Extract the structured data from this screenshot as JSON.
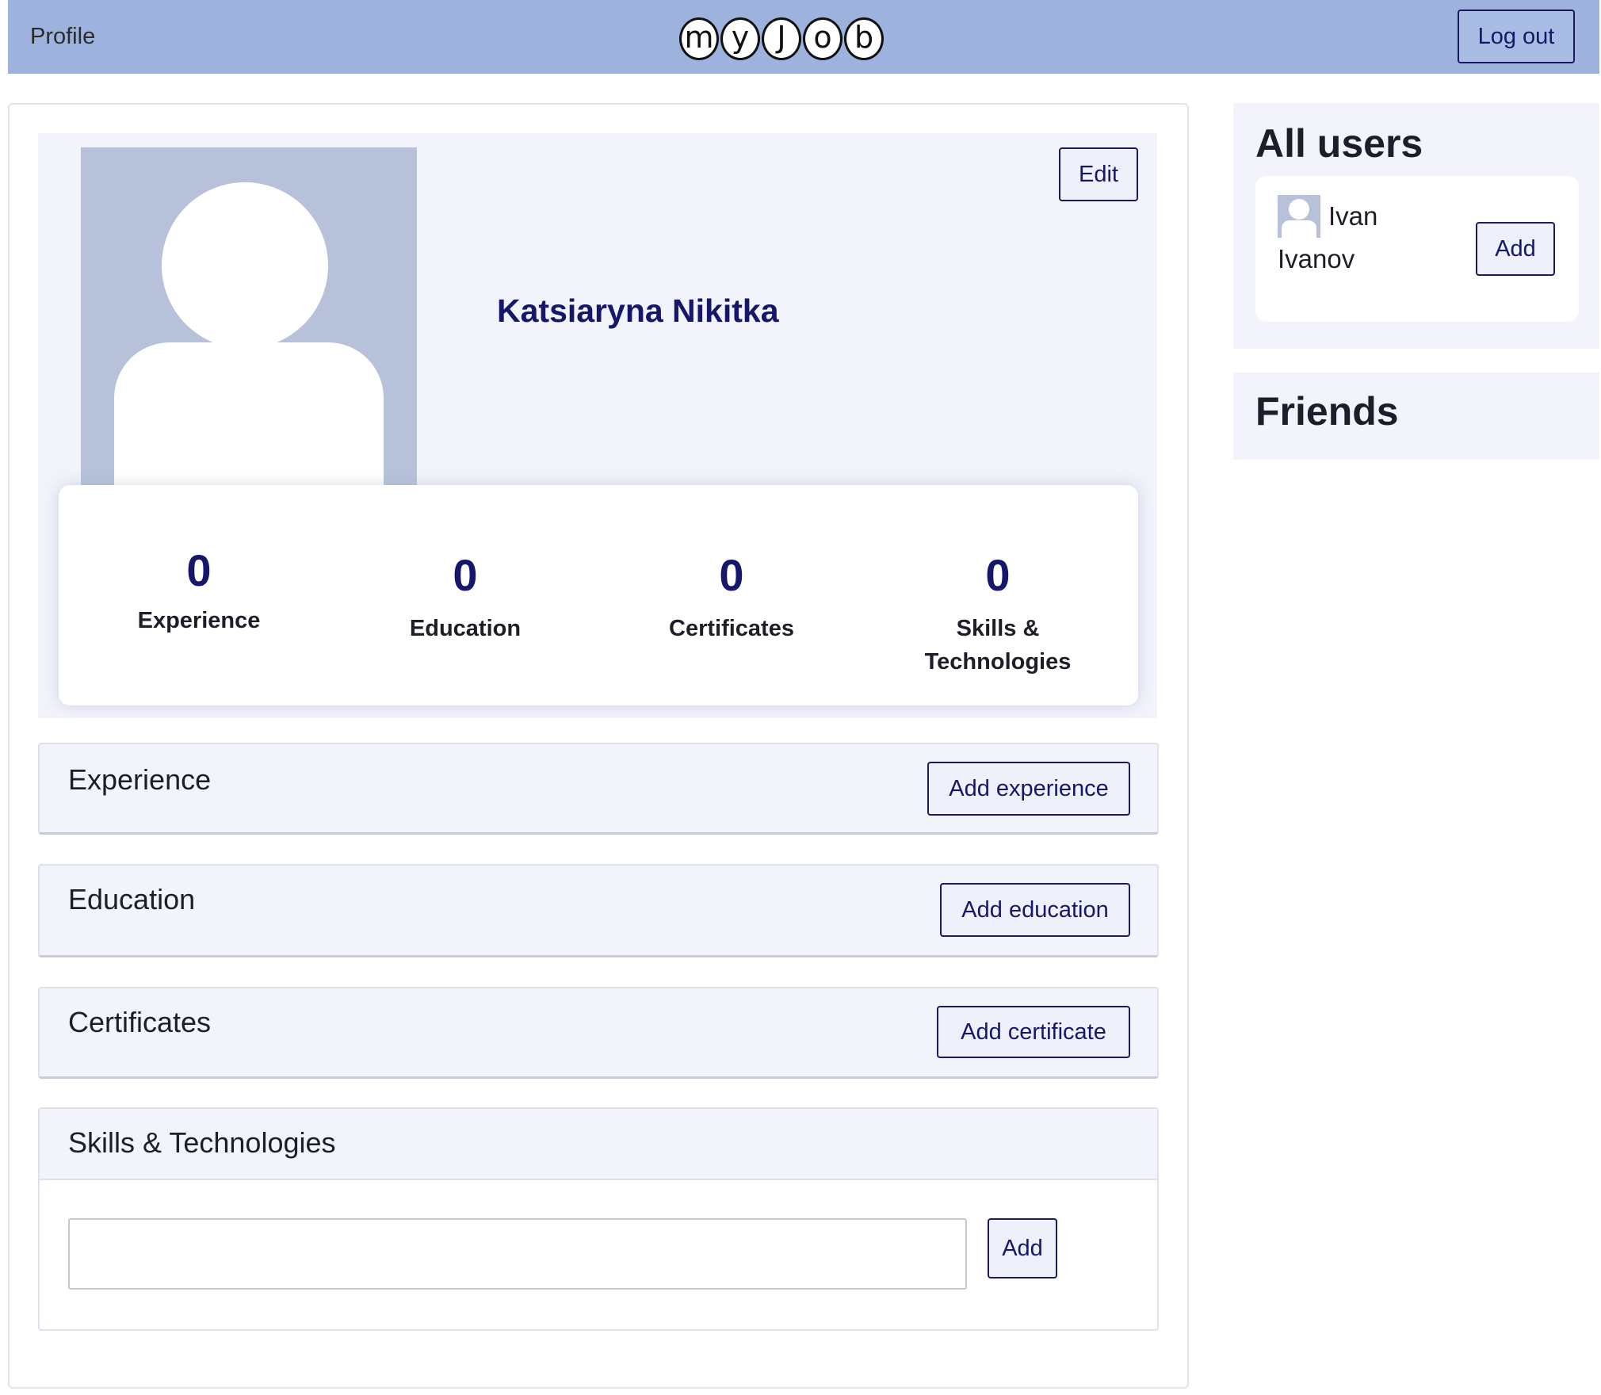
{
  "header": {
    "title": "Profile",
    "logo_letters": [
      "m",
      "y",
      "J",
      "o",
      "b"
    ],
    "logout_label": "Log out"
  },
  "profile": {
    "name": "Katsiaryna Nikitka",
    "edit_label": "Edit",
    "stats": [
      {
        "value": "0",
        "label": "Experience"
      },
      {
        "value": "0",
        "label": "Education"
      },
      {
        "value": "0",
        "label": "Certificates"
      },
      {
        "value": "0",
        "label": "Skills & Technologies"
      }
    ]
  },
  "sections": {
    "experience": {
      "title": "Experience",
      "button": "Add experience"
    },
    "education": {
      "title": "Education",
      "button": "Add education"
    },
    "certificates": {
      "title": "Certificates",
      "button": "Add certificate"
    },
    "skills": {
      "title": "Skills & Technologies",
      "input_value": "",
      "button": "Add"
    }
  },
  "sidebar": {
    "all_users": {
      "title": "All users",
      "users": [
        {
          "name": "Ivan Ivanov",
          "add_label": "Add"
        }
      ]
    },
    "friends": {
      "title": "Friends"
    }
  },
  "colors": {
    "header_bg": "#9db3de",
    "accent": "#16166b",
    "panel_bg": "#f2f3fb",
    "avatar_bg": "#b7c1da"
  },
  "icons": {
    "profile_avatar": "user-placeholder-icon",
    "user_avatar": "user-placeholder-icon"
  }
}
